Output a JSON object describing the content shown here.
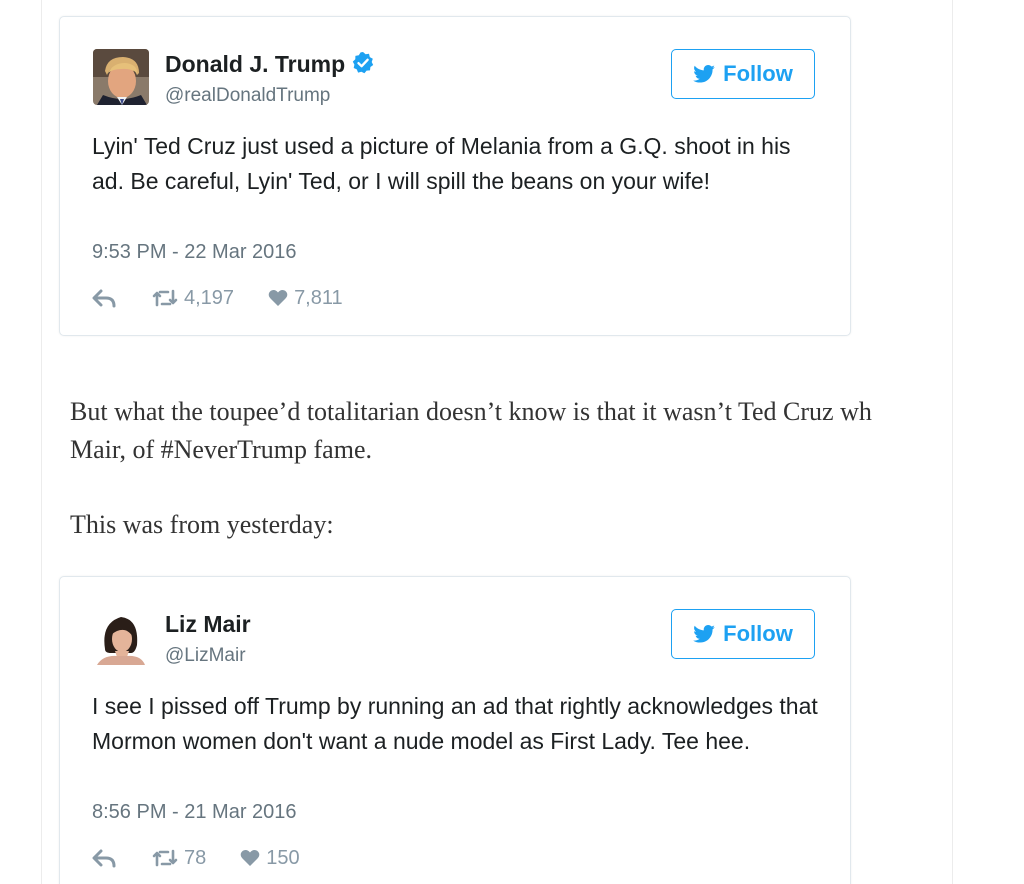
{
  "tweets": [
    {
      "author_name": "Donald J. Trump",
      "verified": true,
      "handle": "@realDonaldTrump",
      "follow_label": "Follow",
      "text": "Lyin' Ted Cruz just used a picture of Melania from a G.Q. shoot in his ad. Be careful, Lyin' Ted, or I will spill the beans on your wife!",
      "timestamp": "9:53 PM - 22 Mar 2016",
      "retweets": "4,197",
      "likes": "7,811",
      "avatar_icon": "person-portrait-suit"
    },
    {
      "author_name": "Liz Mair",
      "verified": false,
      "handle": "@LizMair",
      "follow_label": "Follow",
      "text": "I see I pissed off Trump by running an ad that rightly acknowledges that Mormon women don't want a nude model as First Lady. Tee hee.",
      "timestamp": "8:56 PM - 21 Mar 2016",
      "retweets": "78",
      "likes": "150",
      "avatar_icon": "person-portrait-dark-hair"
    }
  ],
  "article": {
    "paragraph1_line1": "But what the toupee’d totalitarian doesn’t know is that it wasn’t Ted Cruz wh",
    "paragraph1_line2": "Mair, of #NeverTrump fame.",
    "paragraph2": "This was from yesterday:"
  },
  "colors": {
    "twitter_blue": "#1da1f2",
    "verified_blue": "#1da1f2",
    "meta_gray": "#8899a6"
  }
}
